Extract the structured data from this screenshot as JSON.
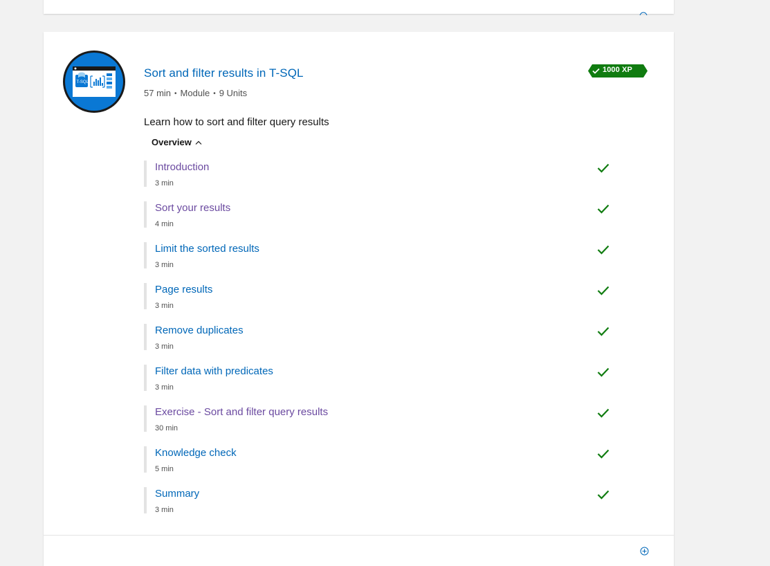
{
  "module": {
    "title": "Sort and filter results in T-SQL",
    "duration": "57 min",
    "separator": "•",
    "type": "Module",
    "units_count": "9 Units",
    "xp": "1000 XP",
    "description": "Learn how to sort and filter query results",
    "overview_label": "Overview",
    "icon_text": "T-SQL"
  },
  "units": [
    {
      "title": "Introduction",
      "duration": "3 min",
      "completed": true,
      "visited": true
    },
    {
      "title": "Sort your results",
      "duration": "4 min",
      "completed": true,
      "visited": true
    },
    {
      "title": "Limit the sorted results",
      "duration": "3 min",
      "completed": true,
      "visited": false
    },
    {
      "title": "Page results",
      "duration": "3 min",
      "completed": true,
      "visited": false
    },
    {
      "title": "Remove duplicates",
      "duration": "3 min",
      "completed": true,
      "visited": false
    },
    {
      "title": "Filter data with predicates",
      "duration": "3 min",
      "completed": true,
      "visited": false
    },
    {
      "title": "Exercise - Sort and filter query results",
      "duration": "30 min",
      "completed": true,
      "visited": true
    },
    {
      "title": "Knowledge check",
      "duration": "5 min",
      "completed": true,
      "visited": false
    },
    {
      "title": "Summary",
      "duration": "3 min",
      "completed": true,
      "visited": false
    }
  ],
  "colors": {
    "link": "#0067b8",
    "visited": "#6b4aa0",
    "check": "#107c10",
    "xp_badge": "#107c10",
    "background": "#f2f2f2"
  },
  "icons": {
    "check": "checkmark-icon",
    "expand": "circle-plus-icon",
    "collapse": "chevron-up-icon"
  }
}
